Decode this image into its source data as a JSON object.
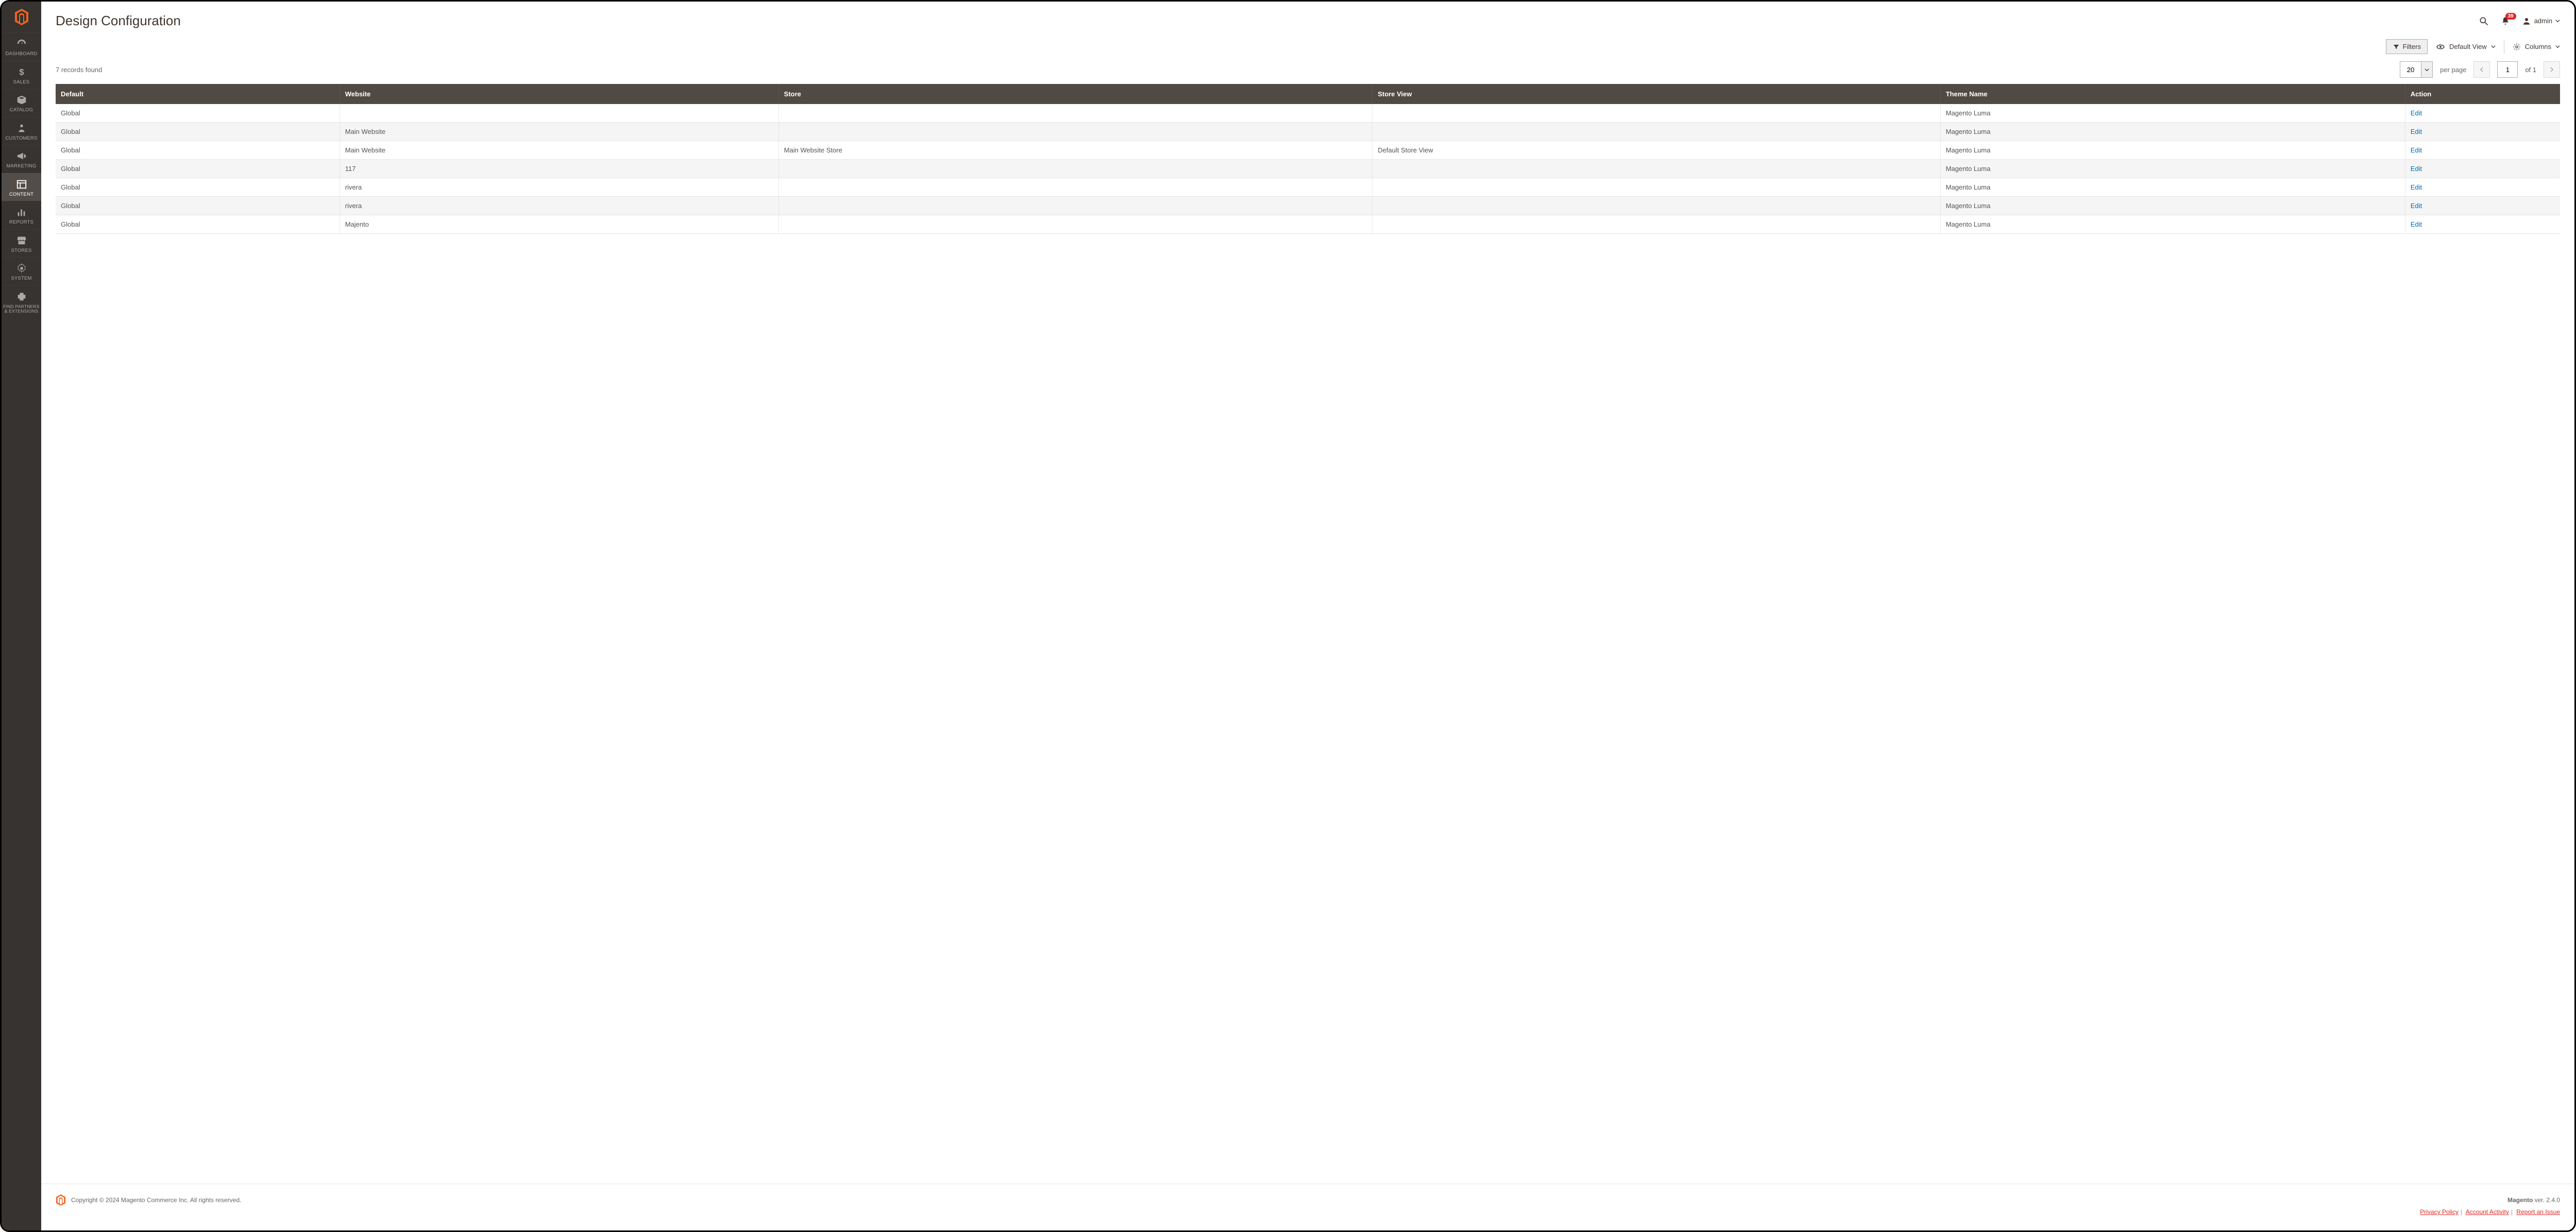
{
  "sidebar": {
    "items": [
      {
        "label": "DASHBOARD"
      },
      {
        "label": "SALES"
      },
      {
        "label": "CATALOG"
      },
      {
        "label": "CUSTOMERS"
      },
      {
        "label": "MARKETING"
      },
      {
        "label": "CONTENT"
      },
      {
        "label": "REPORTS"
      },
      {
        "label": "STORES"
      },
      {
        "label": "SYSTEM"
      },
      {
        "label": "FIND PARTNERS & EXTENSIONS"
      }
    ]
  },
  "header": {
    "page_title": "Design Configuration",
    "notifications_count": "39",
    "admin_label": "admin"
  },
  "toolbar": {
    "filters_label": "Filters",
    "default_view_label": "Default View",
    "columns_label": "Columns"
  },
  "grid": {
    "records_found_text": "7 records found",
    "page_size_value": "20",
    "per_page_label": "per page",
    "current_page": "1",
    "of_pages_text": "of 1",
    "columns": {
      "default": "Default",
      "website": "Website",
      "store": "Store",
      "store_view": "Store View",
      "theme_name": "Theme Name",
      "action": "Action"
    },
    "edit_label": "Edit",
    "rows": [
      {
        "default": "Global",
        "website": "",
        "store": "",
        "store_view": "",
        "theme_name": "Magento Luma"
      },
      {
        "default": "Global",
        "website": "Main Website",
        "store": "",
        "store_view": "",
        "theme_name": "Magento Luma"
      },
      {
        "default": "Global",
        "website": "Main Website",
        "store": "Main Website Store",
        "store_view": "Default Store View",
        "theme_name": "Magento Luma"
      },
      {
        "default": "Global",
        "website": "117",
        "store": "",
        "store_view": "",
        "theme_name": "Magento Luma"
      },
      {
        "default": "Global",
        "website": "rivera",
        "store": "",
        "store_view": "",
        "theme_name": "Magento Luma"
      },
      {
        "default": "Global",
        "website": "rivera",
        "store": "",
        "store_view": "",
        "theme_name": "Magento Luma"
      },
      {
        "default": "Global",
        "website": "Majento",
        "store": "",
        "store_view": "",
        "theme_name": "Magento Luma"
      }
    ]
  },
  "footer": {
    "copyright": "Copyright © 2024 Magento Commerce Inc. All rights reserved.",
    "brand": "Magento",
    "version": " ver. 2.4.0",
    "links": {
      "privacy": "Privacy Policy",
      "account_activity": "Account Activity",
      "report_issue": "Report an Issue"
    }
  }
}
